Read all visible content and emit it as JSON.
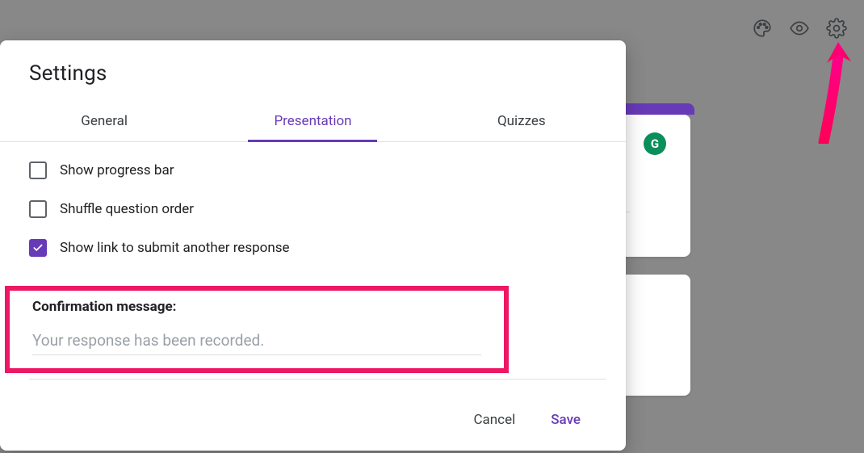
{
  "toolbar": {
    "palette_icon": "customize-theme",
    "preview_icon": "preview",
    "settings_icon": "settings"
  },
  "bg": {
    "grammarly_badge": "G"
  },
  "dialog": {
    "title": "Settings",
    "tabs": {
      "general": "General",
      "presentation": "Presentation",
      "quizzes": "Quizzes"
    },
    "options": {
      "show_progress": {
        "label": "Show progress bar",
        "checked": false
      },
      "shuffle": {
        "label": "Shuffle question order",
        "checked": false
      },
      "submit_another": {
        "label": "Show link to submit another response",
        "checked": true
      }
    },
    "confirmation": {
      "label": "Confirmation message:",
      "placeholder": "Your response has been recorded.",
      "value": ""
    },
    "actions": {
      "cancel": "Cancel",
      "save": "Save"
    }
  },
  "colors": {
    "accent": "#673ab7",
    "highlight": "#ed1764"
  }
}
